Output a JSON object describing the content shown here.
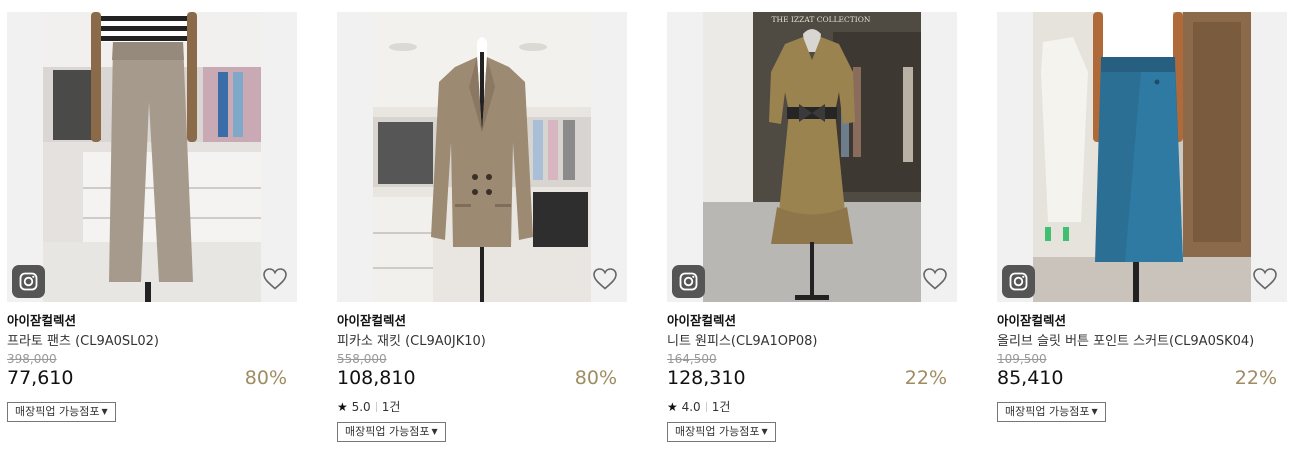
{
  "products": [
    {
      "brand": "아이잗컬렉션",
      "name": "프라토 팬츠 (CL9A0SL02)",
      "original_price": "398,000",
      "price": "77,610",
      "discount": "80%",
      "has_rating": false,
      "pickup_label": "매장픽업 가능점포",
      "pickup_arrow": "▼"
    },
    {
      "brand": "아이잗컬렉션",
      "name": "피카소 재킷 (CL9A0JK10)",
      "original_price": "558,000",
      "price": "108,810",
      "discount": "80%",
      "has_rating": true,
      "rating": "5.0",
      "review_count": "1건",
      "pickup_label": "매장픽업 가능점포",
      "pickup_arrow": "▼"
    },
    {
      "brand": "아이잗컬렉션",
      "name": "니트 원피스(CL9A1OP08)",
      "original_price": "164,500",
      "price": "128,310",
      "discount": "22%",
      "has_rating": true,
      "rating": "4.0",
      "review_count": "1건",
      "pickup_label": "매장픽업 가능점포",
      "pickup_arrow": "▼",
      "photo_sign": "THE IZZAT COLLECTION"
    },
    {
      "brand": "아이잗컬렉션",
      "name": "올리브 슬릿 버튼 포인트 스커트(CL9A0SK04)",
      "original_price": "109,500",
      "price": "85,410",
      "discount": "22%",
      "has_rating": false,
      "pickup_label": "매장픽업 가능점포",
      "pickup_arrow": "▼"
    }
  ],
  "star_glyph": "★",
  "icons": {
    "instagram": "instagram-icon",
    "wishlist": "heart-outline-icon",
    "star": "star-icon",
    "dropdown": "caret-down-icon"
  },
  "colors": {
    "discount": "#9e8c63",
    "original_price": "#999999",
    "thumb_bg": "#f1f1f1",
    "instagram_badge": "#555555"
  }
}
